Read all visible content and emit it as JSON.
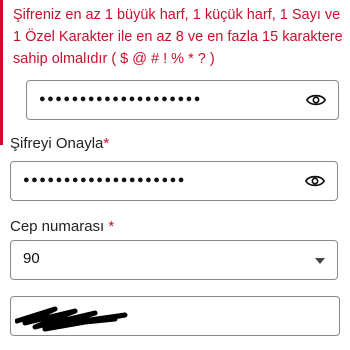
{
  "error": {
    "message": "Şifreniz en az 1 büyük harf, 1 küçük harf, 1 Sayı ve 1 Özel Karakter ile en az 8 ve en fazla 15 karaktere sahip olmalıdır ( $ @ # ! % * ? )",
    "color": "#c8102e"
  },
  "password": {
    "masked_value": "●●●●●●●●●●●●●●●●●●●●",
    "toggle_icon": "eye-icon"
  },
  "confirm_password": {
    "label": "Şifreyi Onayla",
    "required_marker": "*",
    "masked_value": "●●●●●●●●●●●●●●●●●●●●",
    "toggle_icon": "eye-icon"
  },
  "phone": {
    "label": "Cep numarası",
    "required_marker": "*",
    "country_code": "90"
  }
}
